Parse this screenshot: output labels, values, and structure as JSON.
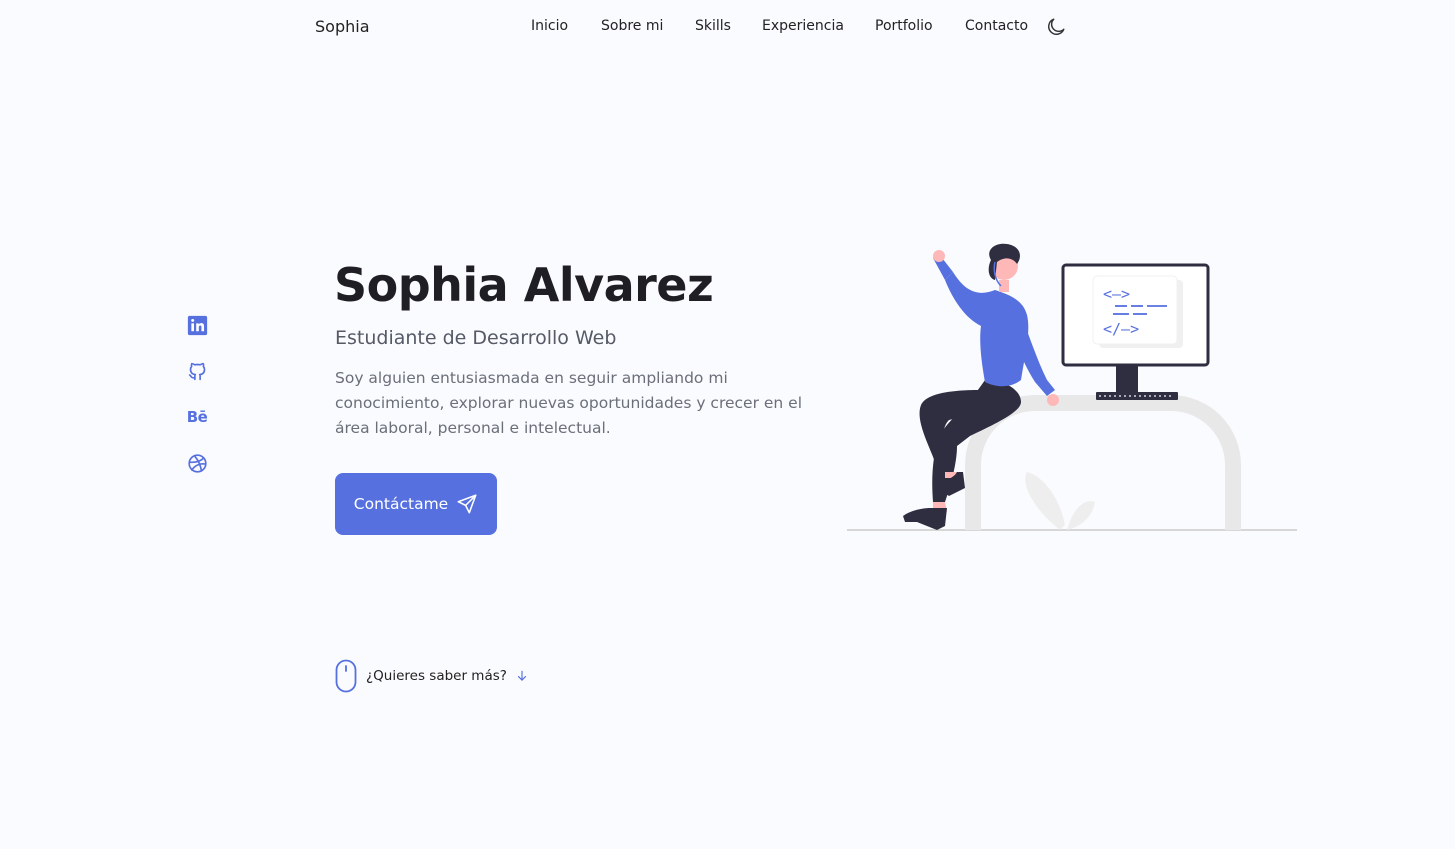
{
  "header": {
    "logo": "Sophia",
    "nav": [
      "Inicio",
      "Sobre mi",
      "Skills",
      "Experiencia",
      "Portfolio",
      "Contacto"
    ]
  },
  "hero": {
    "title": "Sophia Alvarez",
    "subtitle": "Estudiante de Desarrollo Web",
    "description": "Soy alguien entusiasmada en seguir ampliando mi conocimiento, explorar nuevas oportunidades y crecer en el área laboral, personal e intelectual.",
    "button_label": "Contáctame"
  },
  "scroll": {
    "label": "¿Quieres saber más?"
  },
  "social": {
    "behance_text": "Bē",
    "icons": [
      "linkedin-icon",
      "github-icon",
      "behance-icon",
      "dribbble-icon"
    ]
  },
  "illustration": {
    "code_lines": [
      "<—>",
      "</—>"
    ]
  },
  "colors": {
    "accent": "#5670e0",
    "background": "#fafbfe",
    "text": "#222222",
    "muted": "#6a6f7a"
  }
}
